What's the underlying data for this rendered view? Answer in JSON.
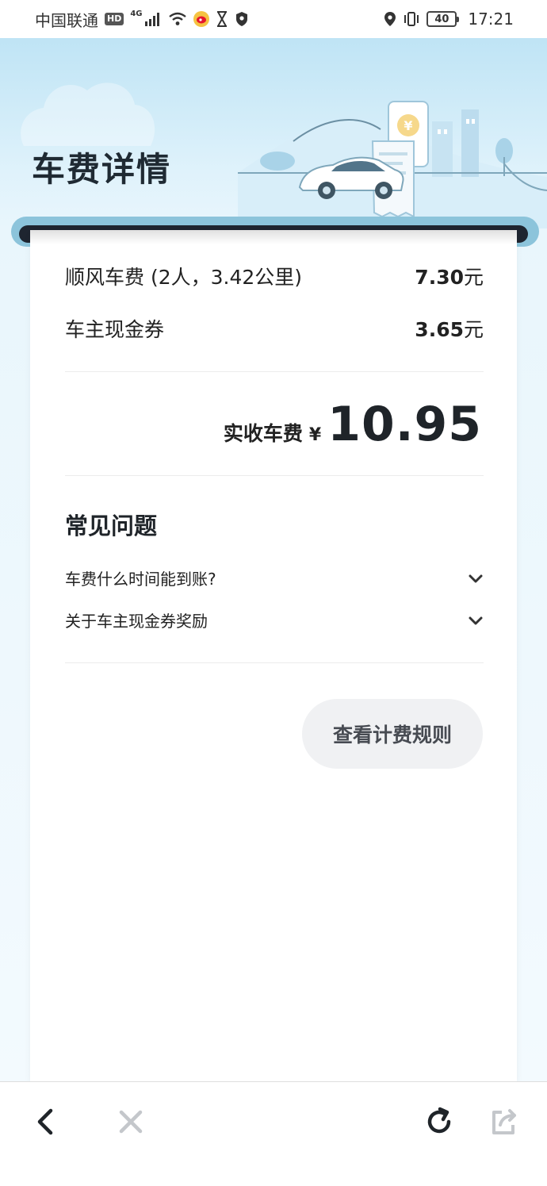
{
  "status_bar": {
    "carrier": "中国联通",
    "hd": "HD",
    "network": "4G",
    "battery": "40",
    "time": "17:21"
  },
  "header": {
    "title": "车费详情"
  },
  "fees": {
    "items": [
      {
        "label": "顺风车费 (2人，3.42公里)",
        "amount": "7.30",
        "unit": "元"
      },
      {
        "label": "车主现金券",
        "amount": "3.65",
        "unit": "元"
      }
    ],
    "total_label": "实收车费",
    "total_currency": "¥",
    "total_amount": "10.95"
  },
  "faq": {
    "title": "常见问题",
    "items": [
      {
        "question": "车费什么时间能到账?"
      },
      {
        "question": "关于车主现金券奖励"
      }
    ]
  },
  "rule_button": {
    "label": "查看计费规则"
  },
  "colors": {
    "header_bg": "#bfe4f5",
    "roller": "#8cc4db",
    "roller_dark": "#1e2530",
    "button_bg": "#f0f1f3"
  },
  "icons": {
    "back": "back-arrow-icon",
    "close": "close-icon",
    "refresh": "refresh-icon",
    "share": "share-icon"
  }
}
